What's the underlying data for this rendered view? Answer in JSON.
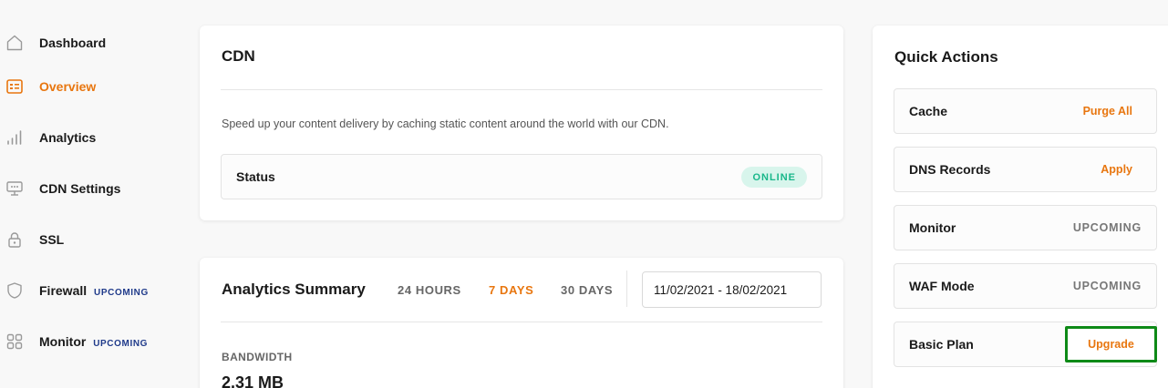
{
  "sidebar": {
    "items": [
      {
        "label": "Dashboard",
        "icon": "home-icon"
      },
      {
        "label": "Overview",
        "icon": "overview-icon"
      },
      {
        "label": "Analytics",
        "icon": "bars-icon"
      },
      {
        "label": "CDN Settings",
        "icon": "monitor-settings-icon"
      },
      {
        "label": "SSL",
        "icon": "lock-icon"
      },
      {
        "label": "Firewall",
        "icon": "shield-icon",
        "tag": "UPCOMING"
      },
      {
        "label": "Monitor",
        "icon": "grid-icon",
        "tag": "UPCOMING"
      }
    ],
    "active": "Overview"
  },
  "cdn": {
    "title": "CDN",
    "description": "Speed up your content delivery by caching static content around the world with our CDN.",
    "status_label": "Status",
    "status_value": "ONLINE"
  },
  "analytics": {
    "title": "Analytics Summary",
    "ranges": [
      "24 HOURS",
      "7 DAYS",
      "30 DAYS"
    ],
    "active_range": "7 DAYS",
    "date_range": "11/02/2021 - 18/02/2021",
    "bandwidth_label": "BANDWIDTH",
    "bandwidth_value": "2.31 MB"
  },
  "quick_actions": {
    "title": "Quick Actions",
    "rows": [
      {
        "label": "Cache",
        "action": "Purge All"
      },
      {
        "label": "DNS Records",
        "action": "Apply"
      },
      {
        "label": "Monitor",
        "action": "UPCOMING"
      },
      {
        "label": "WAF Mode",
        "action": "UPCOMING"
      },
      {
        "label": "Basic Plan",
        "action": "Upgrade"
      }
    ]
  },
  "colors": {
    "accent": "#e8760f",
    "online_bg": "#d8f5ec",
    "online_text": "#19b78a",
    "upcoming_tag": "#1f3a8a",
    "highlight": "#0e8a17"
  }
}
